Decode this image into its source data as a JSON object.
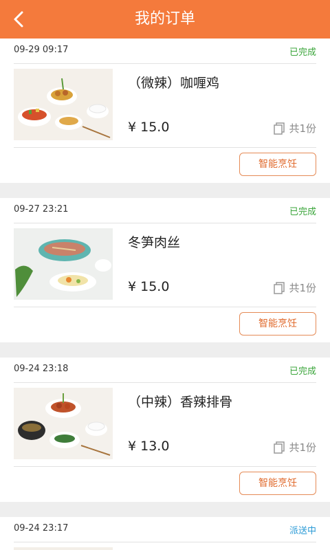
{
  "header": {
    "title": "我的订单",
    "back_icon": "chevron-left-icon"
  },
  "colors": {
    "header_bg": "#f47a3c",
    "status_done": "#3aa53a",
    "status_delivering": "#2a9ad6",
    "button_border": "#e58a55"
  },
  "orders": [
    {
      "time": "09-29 09:17",
      "status": "已完成",
      "name": "（微辣）咖喱鸡",
      "price": "¥ 15.0",
      "qty": "共1份",
      "button": "智能烹饪"
    },
    {
      "time": "09-27 23:21",
      "status": "已完成",
      "name": "冬笋肉丝",
      "price": "¥ 15.0",
      "qty": "共1份",
      "button": "智能烹饪"
    },
    {
      "time": "09-24 23:18",
      "status": "已完成",
      "name": "（中辣）香辣排骨",
      "price": "¥ 13.0",
      "qty": "共1份",
      "button": "智能烹饪"
    },
    {
      "time": "09-24 23:17",
      "status": "派送中"
    }
  ]
}
